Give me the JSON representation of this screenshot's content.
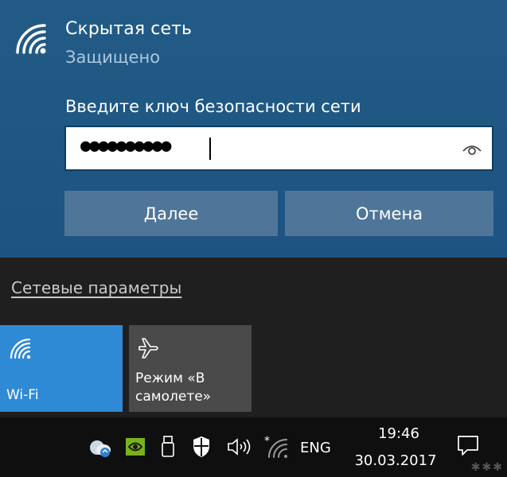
{
  "network": {
    "name": "Скрытая сеть",
    "status": "Защищено",
    "key_label": "Введите ключ безопасности сети",
    "key_value_masked": "●●●●●●●●●●",
    "next_label": "Далее",
    "cancel_label": "Отмена"
  },
  "settings_link": "Сетевые параметры",
  "tiles": [
    {
      "label": "Wi-Fi",
      "icon": "wifi-icon",
      "active": true
    },
    {
      "label": "Режим «В самолете»",
      "icon": "airplane-icon",
      "active": false
    }
  ],
  "taskbar": {
    "language": "ENG",
    "time": "19:46",
    "date": "30.03.2017",
    "icons": [
      "network-status-icon",
      "nvidia-icon",
      "usb-icon",
      "defender-shield-icon",
      "volume-icon",
      "wifi-tray-icon",
      "action-center-icon"
    ]
  },
  "colors": {
    "panel_blue": "#1f5784",
    "button": "#4f7699",
    "tile_active": "#2f8ad6",
    "tile_inactive": "#4a4a4a",
    "taskbar": "#0f0f0f"
  }
}
